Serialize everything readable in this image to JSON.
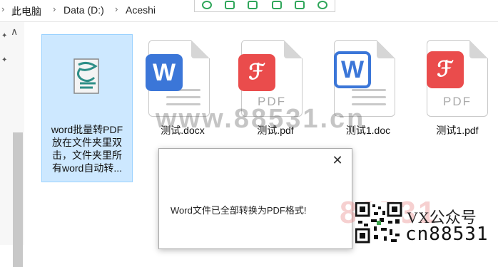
{
  "breadcrumb": {
    "items": [
      "此电脑",
      "Data (D:)",
      "Aceshi"
    ],
    "separator": ">"
  },
  "toolbar": {
    "accent": "#2fa65a"
  },
  "files": [
    {
      "name": "word批量转PDF放在文件夹里双击，文件夹里所有word自动转...",
      "lines": [
        "word批量转PDF",
        "放在文件夹里双",
        "击，文件夹里所",
        "有word自动转..."
      ],
      "icon": "script-icon",
      "selected": true
    },
    {
      "name": "测试.docx",
      "icon": "word-icon"
    },
    {
      "name": "测试.pdf",
      "icon": "pdf-icon",
      "badge_text": "PDF"
    },
    {
      "name": "测试1.doc",
      "icon": "word-doc-icon"
    },
    {
      "name": "测试1.pdf",
      "icon": "pdf-icon",
      "badge_text": "PDF"
    }
  ],
  "dialog": {
    "message": "Word文件已全部转换为PDF格式!",
    "close_symbol": "✕"
  },
  "watermark": {
    "text": "www.88531.cn",
    "text2": "88531"
  },
  "promo": {
    "vx": "VX公众号",
    "cn": "cn88531"
  },
  "colors": {
    "selection": "#cde8ff",
    "word_blue": "#3b76d8",
    "pdf_red": "#ea4c4c"
  }
}
